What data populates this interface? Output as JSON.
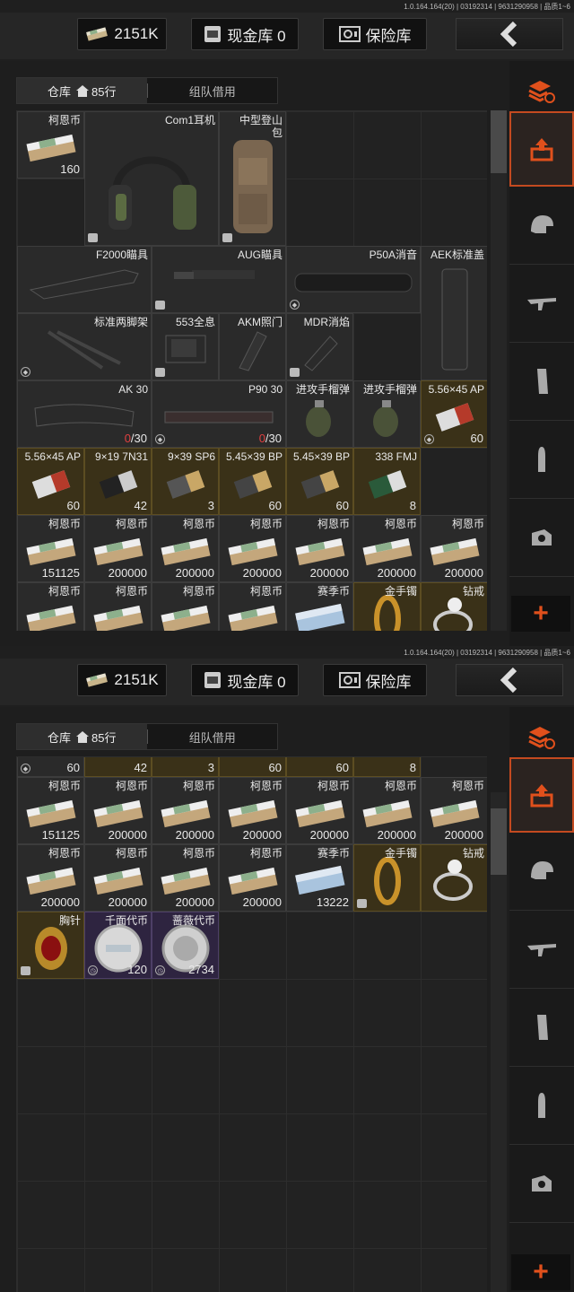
{
  "version": "1.0.164.164(20) | 03192314 | 9631290958 | 品质1~6",
  "header": {
    "money": "2151K",
    "cash_vault": "现金库 0",
    "safe": "保险库"
  },
  "tabs": {
    "warehouse": "仓库",
    "rows": "85行",
    "team_borrow": "组队借用"
  },
  "items": {
    "koen1_name": "柯恩币",
    "koen1_count": "160",
    "headset": "Com1耳机",
    "backpack": "中型登山包",
    "f2000": "F2000瞄具",
    "aug": "AUG瞄具",
    "p50a": "P50A消音",
    "aek": "AEK标准盖",
    "bipod": "标准两脚架",
    "holo553": "553全息",
    "akm": "AKM照门",
    "mdr": "MDR消焰",
    "ak30": "AK 30",
    "ak30_count_red": "0",
    "ak30_count": "/30",
    "p90": "P90 30",
    "p90_count_red": "0",
    "p90_count": "/30",
    "grenade": "进攻手榴弹",
    "a556ap": "5.56×45 AP",
    "a556ap_count": "60",
    "a919": "9×19 7N31",
    "a919_count": "42",
    "a939": "9×39 SP6",
    "a939_count": "3",
    "a545": "5.45×39 BP",
    "a545_count": "60",
    "a338": "338 FMJ",
    "a338_count": "8",
    "koen": "柯恩币",
    "c151125": "151125",
    "c200000": "200000",
    "season": "赛季币",
    "season_count": "13222",
    "bracelet": "金手镯",
    "ring": "钻戒",
    "brooch": "胸针",
    "token1": "千面代币",
    "token1_count": "120",
    "token2": "蔷薇代币",
    "token2_count": "2734"
  },
  "colors": {
    "accent": "#e0501c",
    "gold_cell": "#3a3118",
    "purple_cell": "#2e2440"
  }
}
